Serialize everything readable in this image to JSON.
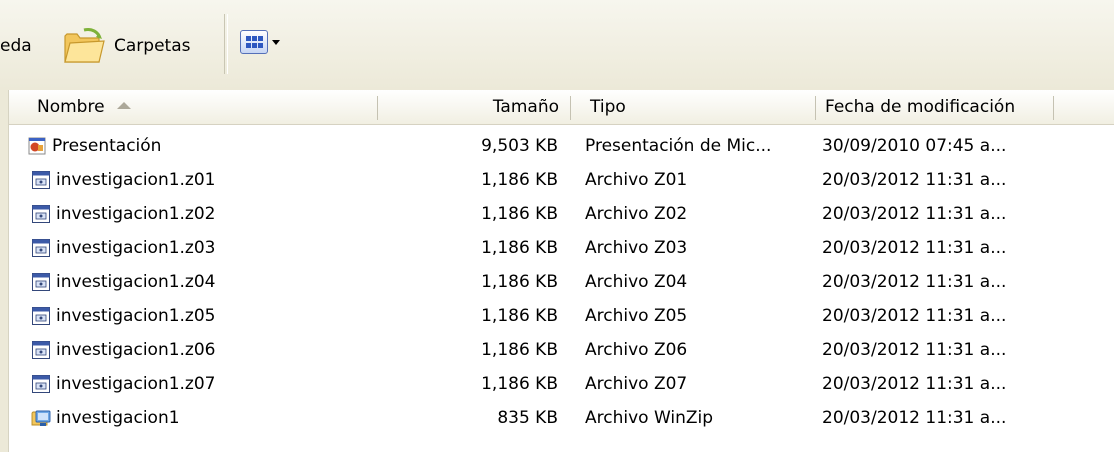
{
  "toolbar": {
    "search_fragment": "eda",
    "folders_label": "Carpetas",
    "folders_icon": "folder-icon",
    "views_icon": "views-icon"
  },
  "columns": {
    "name": "Nombre",
    "size": "Tamaño",
    "type": "Tipo",
    "date": "Fecha de modificación"
  },
  "files": [
    {
      "name": "Presentación",
      "size": "9,503 KB",
      "type": "Presentación de Mic...",
      "date": "30/09/2010 07:45 a...",
      "icon": "powerpoint-icon"
    },
    {
      "name": "investigacion1.z01",
      "size": "1,186 KB",
      "type": "Archivo Z01",
      "date": "20/03/2012 11:31 a...",
      "icon": "generic-file-icon"
    },
    {
      "name": "investigacion1.z02",
      "size": "1,186 KB",
      "type": "Archivo Z02",
      "date": "20/03/2012 11:31 a...",
      "icon": "generic-file-icon"
    },
    {
      "name": "investigacion1.z03",
      "size": "1,186 KB",
      "type": "Archivo Z03",
      "date": "20/03/2012 11:31 a...",
      "icon": "generic-file-icon"
    },
    {
      "name": "investigacion1.z04",
      "size": "1,186 KB",
      "type": "Archivo Z04",
      "date": "20/03/2012 11:31 a...",
      "icon": "generic-file-icon"
    },
    {
      "name": "investigacion1.z05",
      "size": "1,186 KB",
      "type": "Archivo Z05",
      "date": "20/03/2012 11:31 a...",
      "icon": "generic-file-icon"
    },
    {
      "name": "investigacion1.z06",
      "size": "1,186 KB",
      "type": "Archivo Z06",
      "date": "20/03/2012 11:31 a...",
      "icon": "generic-file-icon"
    },
    {
      "name": "investigacion1.z07",
      "size": "1,186 KB",
      "type": "Archivo Z07",
      "date": "20/03/2012 11:31 a...",
      "icon": "generic-file-icon"
    },
    {
      "name": "investigacion1",
      "size": "835 KB",
      "type": "Archivo WinZip",
      "date": "20/03/2012 11:31 a...",
      "icon": "winzip-icon"
    }
  ]
}
